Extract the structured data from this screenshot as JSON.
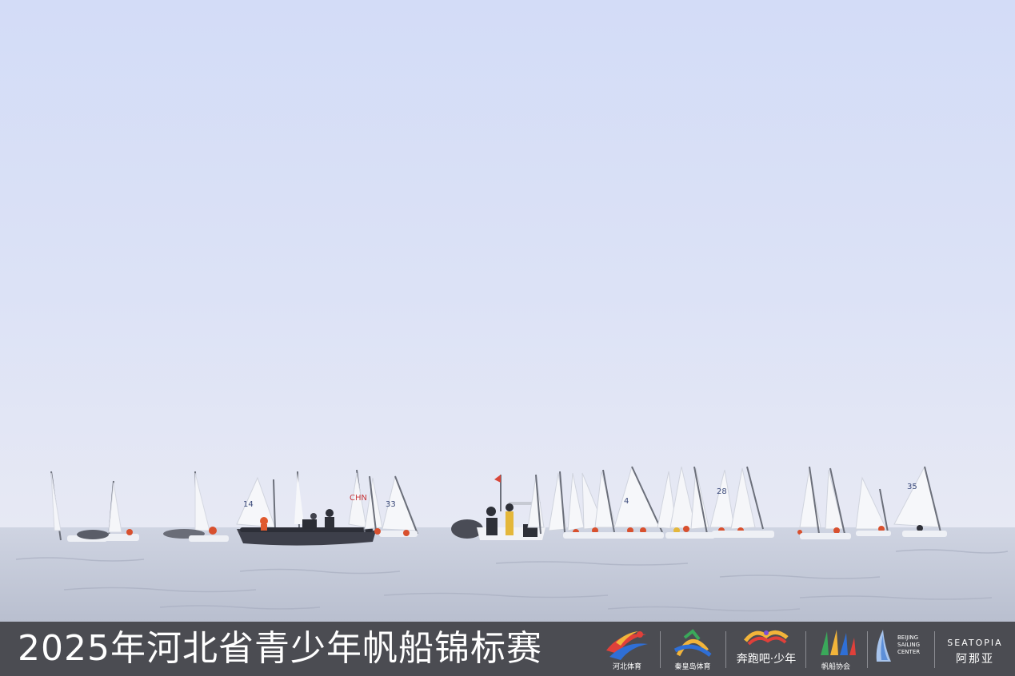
{
  "scene": {
    "description_colors": {
      "sky_top": "#d4ddf6",
      "sky_horizon": "#e6e8f4",
      "sea": "#c4cad8",
      "rib_hull": "#3d3f4a",
      "sail": "#f6f7fa",
      "lifejacket": "#e0502a"
    },
    "sail_numbers": [
      "14",
      "CHN",
      "33",
      "4",
      "28",
      "35"
    ]
  },
  "banner": {
    "title": "2025年河北省青少年帆船锦标赛",
    "logos": [
      {
        "icon": "hebei-sport-swoosh-icon",
        "caption": "河北体育"
      },
      {
        "icon": "qinhuangdao-sailing-icon",
        "caption": "秦皇岛体育"
      },
      {
        "icon": "run-youth-icon",
        "caption": "奔跑吧·少年"
      },
      {
        "icon": "sailing-federation-icon",
        "caption": "帆船协会"
      },
      {
        "icon": "beijing-sailing-icon",
        "caption": "BEIJING SAILING CENTER"
      },
      {
        "icon": "seatopia-icon",
        "caption_en": "SEATOPIA",
        "caption_cn": "阿那亚"
      }
    ]
  }
}
